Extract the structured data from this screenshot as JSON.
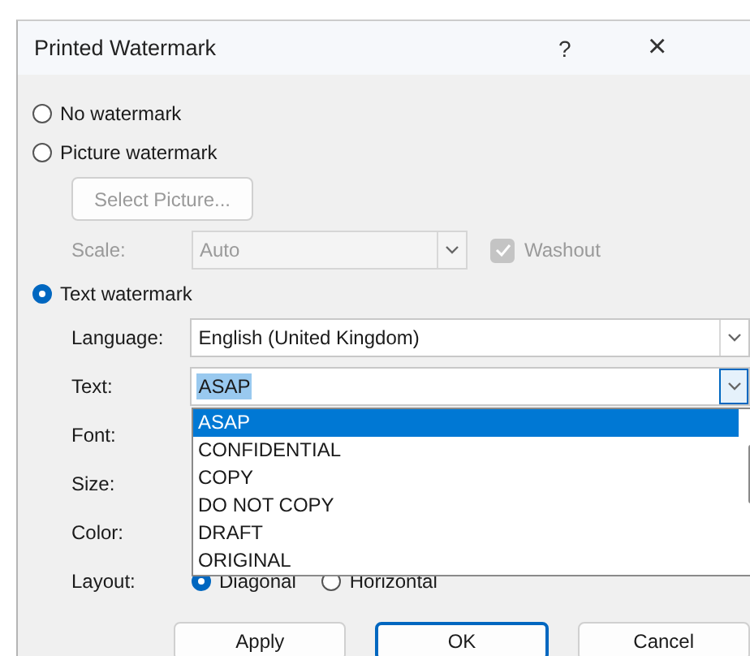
{
  "dialog": {
    "title": "Printed Watermark",
    "help": "?",
    "close": "×"
  },
  "no_watermark": {
    "label": "No watermark",
    "selected": false
  },
  "picture_watermark": {
    "label": "Picture watermark",
    "selected": false,
    "select_button": {
      "label": "Select Picture...",
      "disabled": true
    },
    "scale": {
      "label": "Scale:",
      "value": "Auto",
      "disabled": true
    },
    "washout": {
      "label": "Washout",
      "checked": true,
      "disabled": true
    }
  },
  "text_watermark": {
    "label": "Text watermark",
    "selected": true,
    "language": {
      "label": "Language:",
      "value": "English (United Kingdom)"
    },
    "text": {
      "label": "Text:",
      "value": "ASAP",
      "value_highlighted": true,
      "dropdown_open": true,
      "list": [
        {
          "label": "ASAP",
          "selected": true
        },
        {
          "label": "CONFIDENTIAL",
          "selected": false
        },
        {
          "label": "COPY",
          "selected": false
        },
        {
          "label": "DO NOT COPY",
          "selected": false
        },
        {
          "label": "DRAFT",
          "selected": false
        },
        {
          "label": "ORIGINAL",
          "selected": false
        }
      ]
    },
    "font": {
      "label": "Font:"
    },
    "size": {
      "label": "Size:"
    },
    "color": {
      "label": "Color:"
    },
    "layout": {
      "label": "Layout:",
      "options": [
        {
          "label": "Diagonal",
          "selected": true
        },
        {
          "label": "Horizontal",
          "selected": false
        }
      ]
    }
  },
  "buttons": [
    {
      "label": "Apply",
      "default": false
    },
    {
      "label": "OK",
      "default": true
    },
    {
      "label": "Cancel",
      "default": false
    }
  ]
}
